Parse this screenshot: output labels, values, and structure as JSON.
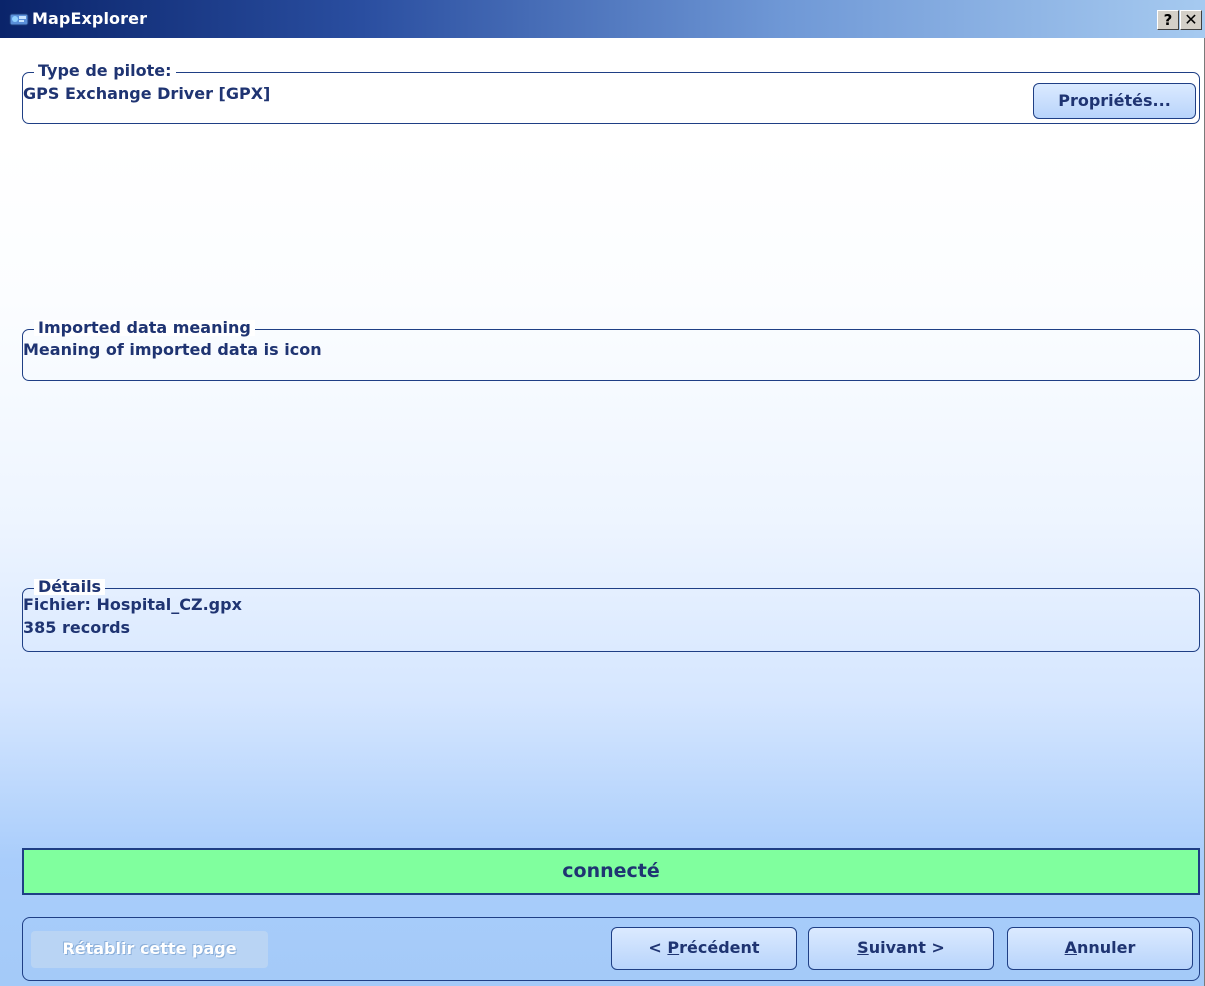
{
  "window": {
    "title": "MapExplorer",
    "help_label": "?",
    "close_label": "✕"
  },
  "driver_group": {
    "legend": "Type de pilote:",
    "value": "GPS Exchange Driver [GPX]",
    "properties_button": "Propriétés..."
  },
  "meaning_group": {
    "legend": "Imported data meaning",
    "value": "Meaning of imported data is  icon"
  },
  "details_group": {
    "legend": "Détails",
    "lines": [
      "Fichier: Hospital_CZ.gpx",
      "385 records"
    ]
  },
  "status": {
    "text": "connecté",
    "color": "#80ff9e"
  },
  "footer": {
    "reset_label": "Rétablir cette page",
    "prev": {
      "accel": "P",
      "rest": "récédent",
      "prefix": "< "
    },
    "next": {
      "accel": "S",
      "rest": "uivant >"
    },
    "cancel": {
      "accel": "A",
      "rest": "nnuler"
    }
  },
  "colors": {
    "title_gradient_start": "#0a246a",
    "title_gradient_end": "#a6caf0",
    "accent": "#1f3f85",
    "text": "#1f3472"
  }
}
